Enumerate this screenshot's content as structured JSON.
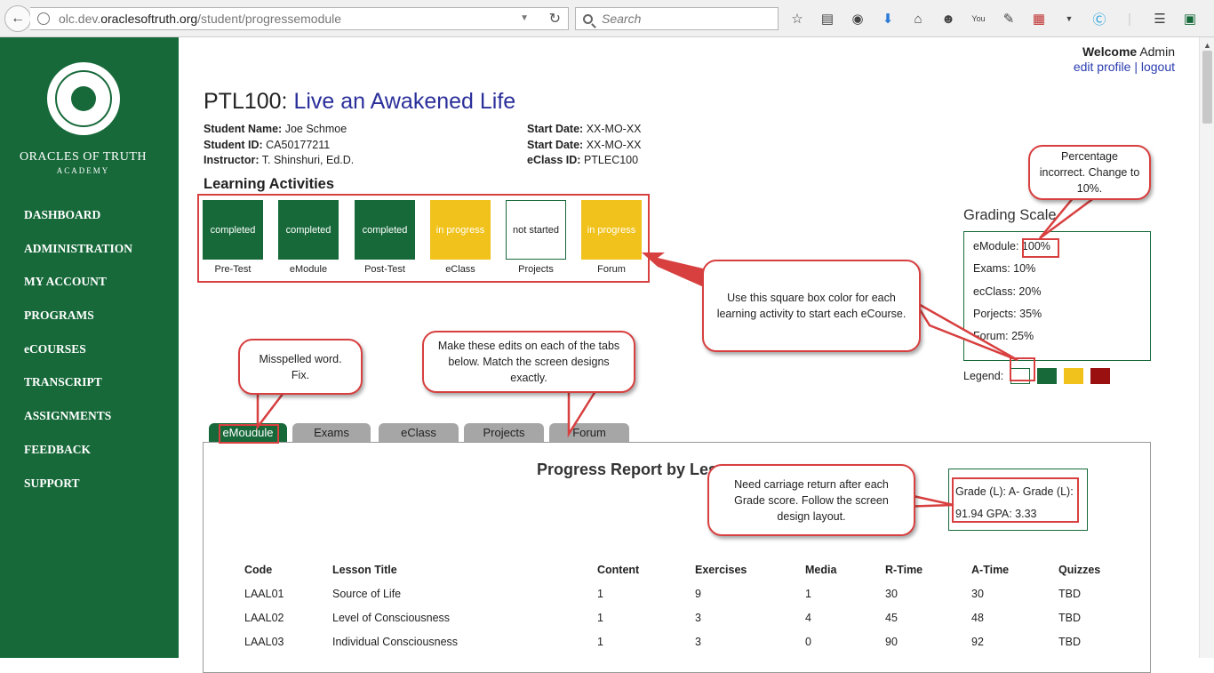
{
  "browser": {
    "url_prefix": "olc.dev.",
    "url_host": "oraclesoftruth.org",
    "url_path": "/student/progressemodule",
    "search_placeholder": "Search"
  },
  "sidebar": {
    "logo_name": "ORACLES OF TRUTH",
    "logo_sub": "ACADEMY",
    "items": [
      {
        "label": "DASHBOARD"
      },
      {
        "label": "ADMINISTRATION"
      },
      {
        "label": "MY ACCOUNT"
      },
      {
        "label": "PROGRAMS"
      },
      {
        "label": "eCOURSES"
      },
      {
        "label": "TRANSCRIPT"
      },
      {
        "label": "ASSIGNMENTS"
      },
      {
        "label": "FEEDBACK"
      },
      {
        "label": "SUPPORT"
      }
    ]
  },
  "header": {
    "welcome": "Welcome",
    "user": "Admin",
    "edit_profile": "edit profile",
    "separator": "|",
    "logout": "logout"
  },
  "course": {
    "code": "PTL100:",
    "name": "Live an Awakened Life"
  },
  "student": {
    "name_label": "Student Name:",
    "name": "Joe Schmoe",
    "id_label": "Student ID:",
    "id": "CA50177211",
    "instructor_label": "Instructor:",
    "instructor": "T. Shinshuri, Ed.D.",
    "start1_label": "Start Date:",
    "start1": "XX-MO-XX",
    "start2_label": "Start Date:",
    "start2": "XX-MO-XX",
    "eclass_label": "eClass ID:",
    "eclass": "PTLEC100"
  },
  "activities": {
    "title": "Learning Activities",
    "items": [
      {
        "status": "completed",
        "label": "Pre-Test",
        "color": "#17693a"
      },
      {
        "status": "completed",
        "label": "eModule",
        "color": "#17693a"
      },
      {
        "status": "completed",
        "label": "Post-Test",
        "color": "#17693a"
      },
      {
        "status": "in progress",
        "label": "eClass",
        "color": "#f1c21b"
      },
      {
        "status": "not started",
        "label": "Projects",
        "color": "#ffffff"
      },
      {
        "status": "in progress",
        "label": "Forum",
        "color": "#f1c21b"
      }
    ]
  },
  "grading": {
    "title": "Grading Scale",
    "rows": [
      {
        "label": "eModule:",
        "value": "100%"
      },
      {
        "label": "Exams:",
        "value": "10%"
      },
      {
        "label": "ecClass:",
        "value": "20%"
      },
      {
        "label": "Porjects:",
        "value": "35%"
      },
      {
        "label": "Forum:",
        "value": "25%"
      }
    ],
    "legend_label": "Legend:",
    "legend_colors": [
      "#ffffff",
      "#17693a",
      "#f1c21b",
      "#9a0f0f"
    ]
  },
  "tabs": [
    {
      "label": "eMoudule",
      "active": true
    },
    {
      "label": "Exams",
      "active": false
    },
    {
      "label": "eClass",
      "active": false
    },
    {
      "label": "Projects",
      "active": false
    },
    {
      "label": "Forum",
      "active": false
    }
  ],
  "report": {
    "title": "Progress Report by Less",
    "grade_line1": "Grade (L): A- Grade (L):",
    "grade_line2": "91.94 GPA: 3.33"
  },
  "lessons": {
    "headers": [
      "Code",
      "Lesson Title",
      "Content",
      "Exercises",
      "Media",
      "R-Time",
      "A-Time",
      "Quizzes"
    ],
    "rows": [
      [
        "LAAL01",
        "Source of Life",
        "1",
        "9",
        "1",
        "30",
        "30",
        "TBD"
      ],
      [
        "LAAL02",
        "Level of Consciousness",
        "1",
        "3",
        "4",
        "45",
        "48",
        "TBD"
      ],
      [
        "LAAL03",
        "Individual Consciousness",
        "1",
        "3",
        "0",
        "90",
        "92",
        "TBD"
      ]
    ]
  },
  "annotations": {
    "percentage": "Percentage incorrect. Change to 10%.",
    "square_box": "Use this square box color for each learning activity to start each eCourse.",
    "edits": "Make these edits on each of the tabs below. Match the screen designs exactly.",
    "misspelled": "Misspelled word. Fix.",
    "carriage": "Need carriage return after each Grade score. Follow the screen design layout.",
    "accent_color": "#d84040"
  }
}
